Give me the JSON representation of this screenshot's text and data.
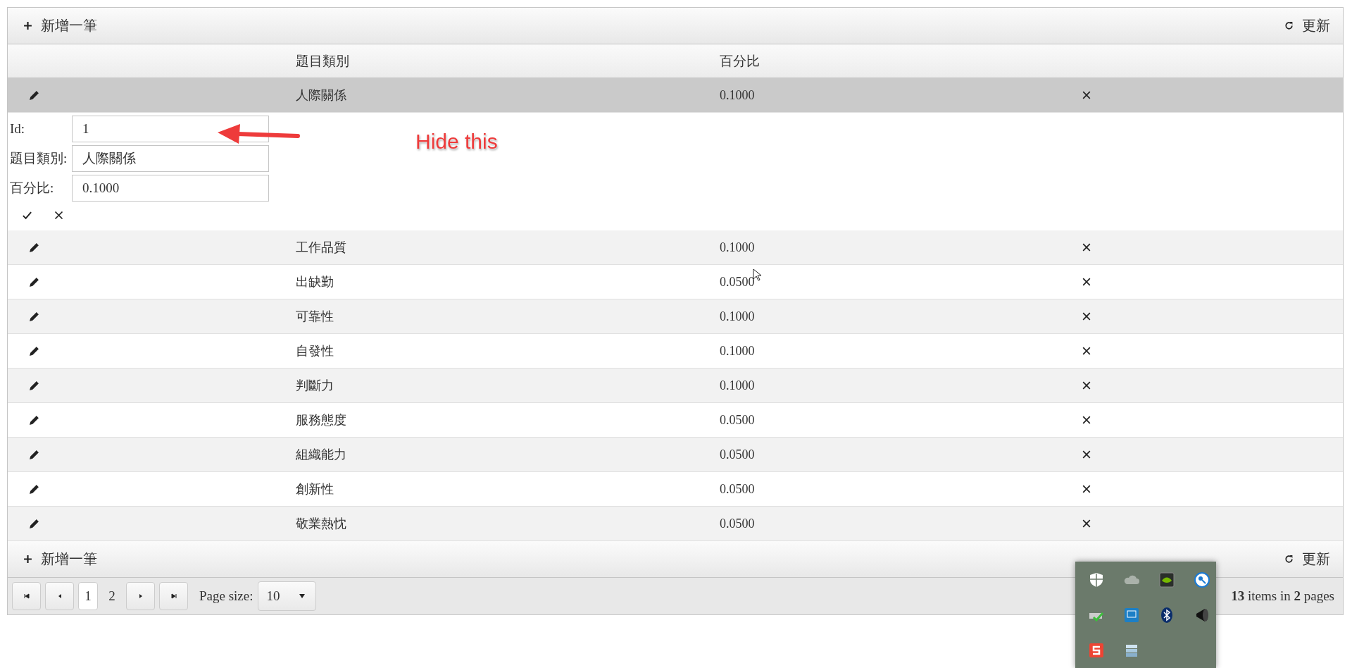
{
  "toolbar_top": {
    "add_label": "新增一筆",
    "refresh_label": "更新"
  },
  "columns": [
    "題目類別",
    "百分比"
  ],
  "rows": [
    {
      "category": "人際關係",
      "percent": "0.1000",
      "selected": true,
      "editing": true
    },
    {
      "category": "工作品質",
      "percent": "0.1000",
      "selected": false,
      "editing": false
    },
    {
      "category": "出缺勤",
      "percent": "0.0500",
      "selected": false,
      "editing": false
    },
    {
      "category": "可靠性",
      "percent": "0.1000",
      "selected": false,
      "editing": false
    },
    {
      "category": "自發性",
      "percent": "0.1000",
      "selected": false,
      "editing": false
    },
    {
      "category": "判斷力",
      "percent": "0.1000",
      "selected": false,
      "editing": false
    },
    {
      "category": "服務態度",
      "percent": "0.0500",
      "selected": false,
      "editing": false
    },
    {
      "category": "組織能力",
      "percent": "0.0500",
      "selected": false,
      "editing": false
    },
    {
      "category": "創新性",
      "percent": "0.0500",
      "selected": false,
      "editing": false
    },
    {
      "category": "敬業熱忱",
      "percent": "0.0500",
      "selected": false,
      "editing": false
    }
  ],
  "edit_form": {
    "fields": [
      {
        "label": "Id:",
        "value": "1"
      },
      {
        "label": "題目類別:",
        "value": "人際關係"
      },
      {
        "label": "百分比:",
        "value": "0.1000"
      }
    ]
  },
  "annotation": {
    "text": "Hide this"
  },
  "toolbar_bottom": {
    "add_label": "新增一筆",
    "refresh_label": "更新"
  },
  "pager": {
    "pages": [
      {
        "label": "1",
        "selected": true
      },
      {
        "label": "2",
        "selected": false
      }
    ],
    "page_size_label": "Page size:",
    "page_size": "10",
    "info": "**13** items in **2** pages"
  }
}
